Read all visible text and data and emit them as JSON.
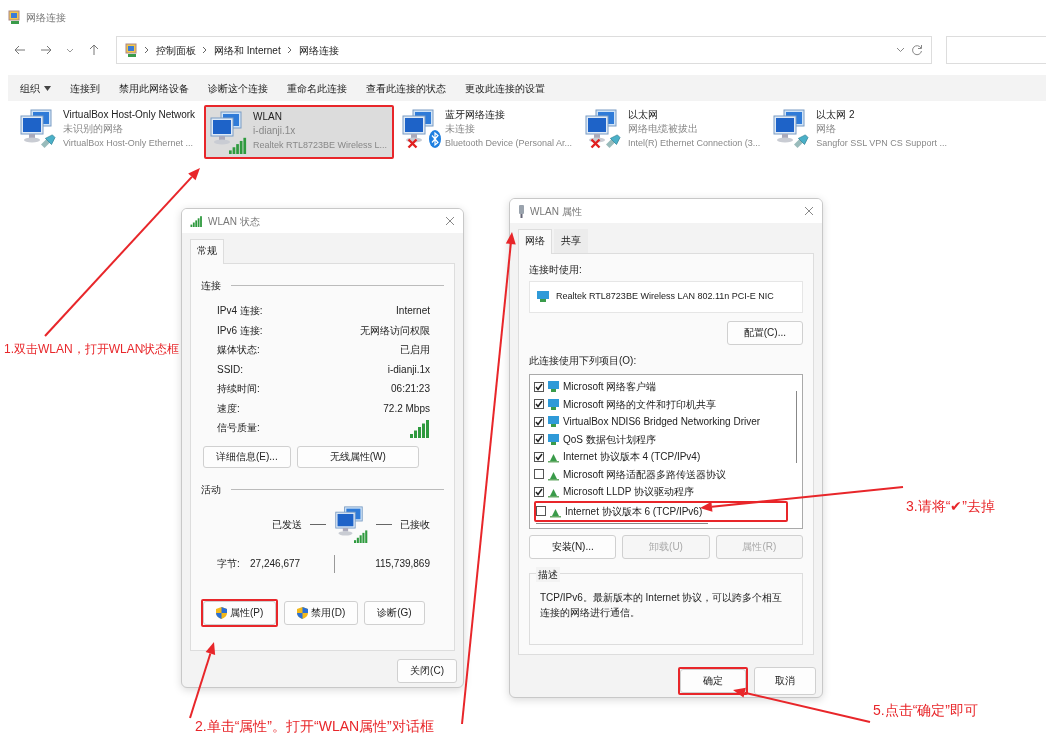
{
  "window": {
    "title": "网络连接"
  },
  "address": {
    "crumbs": [
      "控制面板",
      "网络和 Internet",
      "网络连接"
    ]
  },
  "commands": [
    {
      "label": "组织",
      "dropdown": true
    },
    {
      "label": "连接到",
      "dropdown": false
    },
    {
      "label": "禁用此网络设备",
      "dropdown": false
    },
    {
      "label": "诊断这个连接",
      "dropdown": false
    },
    {
      "label": "重命名此连接",
      "dropdown": false
    },
    {
      "label": "查看此连接的状态",
      "dropdown": false
    },
    {
      "label": "更改此连接的设置",
      "dropdown": false
    }
  ],
  "connections": [
    {
      "name": "VirtualBox Host-Only Network",
      "status": "未识别的网络",
      "device": "VirtualBox Host-Only Ethernet ...",
      "kind": "cable",
      "disconnected": false,
      "selected": false,
      "highlighted": false
    },
    {
      "name": "WLAN",
      "status": "i-dianji.1x",
      "device": "Realtek RTL8723BE Wireless L...",
      "kind": "signal",
      "disconnected": false,
      "selected": true,
      "highlighted": true
    },
    {
      "name": "蓝牙网络连接",
      "status": "未连接",
      "device": "Bluetooth Device (Personal Ar...",
      "kind": "bluetooth",
      "disconnected": true,
      "selected": false,
      "highlighted": false
    },
    {
      "name": "以太网",
      "status": "网络电缆被拔出",
      "device": "Intel(R) Ethernet Connection (3...",
      "kind": "cable",
      "disconnected": true,
      "selected": false,
      "highlighted": false
    },
    {
      "name": "以太网 2",
      "status": "网络",
      "device": "Sangfor SSL VPN CS Support ...",
      "kind": "cable",
      "disconnected": false,
      "selected": false,
      "highlighted": false
    }
  ],
  "status_dialog": {
    "title": "WLAN 状态",
    "tabs": [
      {
        "label": "常规",
        "selected": true
      }
    ],
    "connection_heading": "连接",
    "rows": [
      {
        "kind": "text",
        "label": "IPv4 连接:",
        "value": "Internet"
      },
      {
        "kind": "text",
        "label": "IPv6 连接:",
        "value": "无网络访问权限"
      },
      {
        "kind": "text",
        "label": "媒体状态:",
        "value": "已启用"
      },
      {
        "kind": "text",
        "label": "SSID:",
        "value": "i-dianji.1x"
      },
      {
        "kind": "text",
        "label": "持续时间:",
        "value": "06:21:23"
      },
      {
        "kind": "text",
        "label": "速度:",
        "value": "72.2 Mbps"
      },
      {
        "kind": "signal",
        "label": "信号质量:"
      }
    ],
    "detail_buttons": [
      "详细信息(E)...",
      "无线属性(W)"
    ],
    "activity_heading": "活动",
    "sent_label": "已发送",
    "received_label": "已接收",
    "bytes_label": "字节:",
    "bytes_sent": "27,246,677",
    "bytes_received": "115,739,869",
    "buttons": [
      {
        "label": "属性(P)",
        "shield": true,
        "highlighted": true
      },
      {
        "label": "禁用(D)",
        "shield": true,
        "highlighted": false
      },
      {
        "label": "诊断(G)",
        "shield": false,
        "highlighted": false
      }
    ],
    "close_button": "关闭(C)"
  },
  "properties_dialog": {
    "title": "WLAN 属性",
    "tabs": [
      {
        "label": "网络",
        "selected": true
      },
      {
        "label": "共享",
        "selected": false
      }
    ],
    "connect_using_label": "连接时使用:",
    "adapter": "Realtek RTL8723BE Wireless LAN 802.11n PCI-E NIC",
    "configure_button": "配置(C)...",
    "items_label": "此连接使用下列项目(O):",
    "items": [
      {
        "label": "Microsoft 网络客户端",
        "checked": true,
        "kind": "network",
        "highlighted": false
      },
      {
        "label": "Microsoft 网络的文件和打印机共享",
        "checked": true,
        "kind": "network",
        "highlighted": false
      },
      {
        "label": "VirtualBox NDIS6 Bridged Networking Driver",
        "checked": true,
        "kind": "network",
        "highlighted": false
      },
      {
        "label": "QoS 数据包计划程序",
        "checked": true,
        "kind": "network",
        "highlighted": false
      },
      {
        "label": "Internet 协议版本 4 (TCP/IPv4)",
        "checked": true,
        "kind": "protocol",
        "highlighted": false
      },
      {
        "label": "Microsoft 网络适配器多路传送器协议",
        "checked": false,
        "kind": "protocol",
        "highlighted": false
      },
      {
        "label": "Microsoft LLDP 协议驱动程序",
        "checked": true,
        "kind": "protocol",
        "highlighted": false
      },
      {
        "label": "Internet 协议版本 6 (TCP/IPv6)",
        "checked": false,
        "kind": "protocol",
        "highlighted": true
      }
    ],
    "item_buttons": [
      {
        "label": "安装(N)...",
        "disabled": false
      },
      {
        "label": "卸载(U)",
        "disabled": true
      },
      {
        "label": "属性(R)",
        "disabled": true
      }
    ],
    "description_heading": "描述",
    "description": "TCP/IPv6。最新版本的 Internet 协议，可以跨多个相互连接的网络进行通信。",
    "ok_button": {
      "label": "确定",
      "highlighted": true
    },
    "cancel_button": "取消"
  },
  "annotations": [
    "1.双击WLAN，打开WLAN状态框",
    "2.单击“属性”。打开“WLAN属性”对话框",
    "3.请将“✔”去掉",
    "5.点击“确定”即可"
  ]
}
